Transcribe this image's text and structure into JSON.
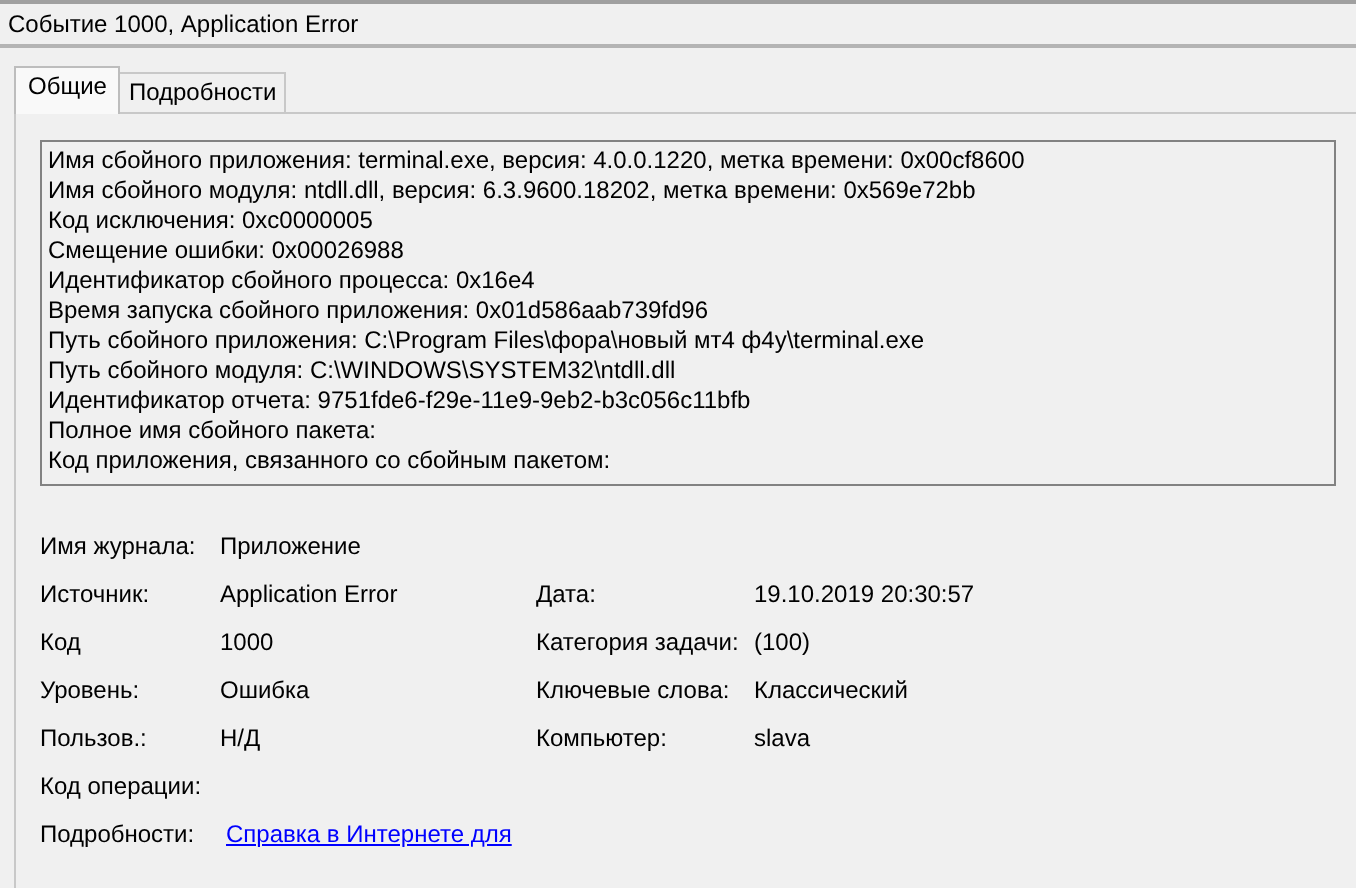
{
  "window": {
    "title": "Событие 1000, Application Error"
  },
  "tabs": [
    {
      "label": "Общие",
      "selected": true
    },
    {
      "label": "Подробности",
      "selected": false
    }
  ],
  "description": [
    "Имя сбойного приложения: terminal.exe, версия: 4.0.0.1220, метка времени: 0x00cf8600",
    "Имя сбойного модуля: ntdll.dll, версия: 6.3.9600.18202, метка времени: 0x569e72bb",
    "Код исключения: 0xc0000005",
    "Смещение ошибки: 0x00026988",
    "Идентификатор сбойного процесса: 0x16e4",
    "Время запуска сбойного приложения: 0x01d586aab739fd96",
    "Путь сбойного приложения: C:\\Program Files\\фора\\новый мт4 ф4у\\terminal.exe",
    "Путь сбойного модуля: C:\\WINDOWS\\SYSTEM32\\ntdll.dll",
    "Идентификатор отчета: 9751fde6-f29e-11e9-9eb2-b3c056c11bfb",
    "Полное имя сбойного пакета:",
    "Код приложения, связанного со сбойным пакетом:"
  ],
  "fields": [
    {
      "label": "Имя журнала:",
      "value": "Приложение"
    },
    {
      "label": "Источник:",
      "value": "Application Error",
      "label_2": "Дата:",
      "value_2": "19.10.2019 20:30:57"
    },
    {
      "label": "Код",
      "value": "1000",
      "label_2": "Категория задачи:",
      "value_2": "(100)"
    },
    {
      "label": "Уровень:",
      "value": "Ошибка",
      "label_2": "Ключевые слова:",
      "value_2": "Классический"
    },
    {
      "label": "Пользов.:",
      "value": "Н/Д",
      "label_2": "Компьютер:",
      "value_2": "slava"
    },
    {
      "label": "Код операции:"
    },
    {
      "label": "Подробности:",
      "link": "Справка в Интернете для"
    }
  ]
}
